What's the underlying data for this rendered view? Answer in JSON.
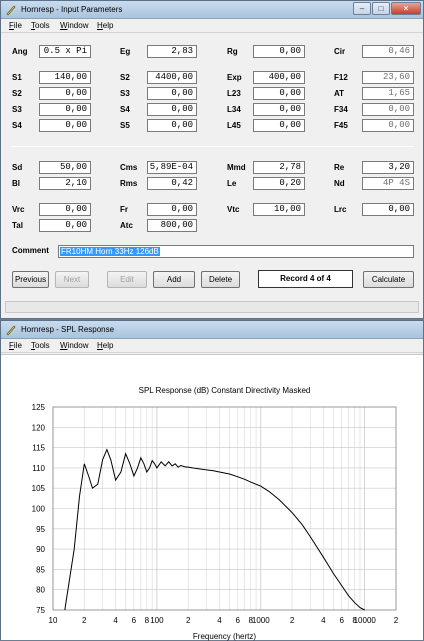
{
  "input_window": {
    "title": "Hornresp - Input Parameters",
    "menu": [
      "File",
      "Tools",
      "Window",
      "Help"
    ],
    "params_top": [
      {
        "id": "ang",
        "label": "Ang",
        "value": "0.5 x Pi"
      },
      {
        "id": "eg",
        "label": "Eg",
        "value": "2,83"
      },
      {
        "id": "rg",
        "label": "Rg",
        "value": "0,00"
      },
      {
        "id": "cir",
        "label": "Cir",
        "value": "0,46",
        "readonly": true
      },
      {
        "id": "s1",
        "label": "S1",
        "value": "140,00"
      },
      {
        "id": "s2a",
        "label": "S2",
        "value": "4400,00"
      },
      {
        "id": "exp",
        "label": "Exp",
        "value": "400,00"
      },
      {
        "id": "f12",
        "label": "F12",
        "value": "23,60",
        "readonly": true
      },
      {
        "id": "s2",
        "label": "S2",
        "value": "0,00"
      },
      {
        "id": "s3a",
        "label": "S3",
        "value": "0,00"
      },
      {
        "id": "l23",
        "label": "L23",
        "value": "0,00"
      },
      {
        "id": "at",
        "label": "AT",
        "value": "1,65",
        "readonly": true
      },
      {
        "id": "s3",
        "label": "S3",
        "value": "0,00"
      },
      {
        "id": "s4a",
        "label": "S4",
        "value": "0,00"
      },
      {
        "id": "l34",
        "label": "L34",
        "value": "0,00"
      },
      {
        "id": "f34",
        "label": "F34",
        "value": "0,00",
        "readonly": true
      },
      {
        "id": "s4",
        "label": "S4",
        "value": "0,00"
      },
      {
        "id": "s5",
        "label": "S5",
        "value": "0,00"
      },
      {
        "id": "l45",
        "label": "L45",
        "value": "0,00"
      },
      {
        "id": "f45",
        "label": "F45",
        "value": "0,00",
        "readonly": true
      }
    ],
    "params_bottom": [
      {
        "id": "sd",
        "label": "Sd",
        "value": "50,00"
      },
      {
        "id": "cms",
        "label": "Cms",
        "value": "5,89E-04"
      },
      {
        "id": "mmd",
        "label": "Mmd",
        "value": "2,78"
      },
      {
        "id": "re",
        "label": "Re",
        "value": "3,20"
      },
      {
        "id": "bl",
        "label": "Bl",
        "value": "2,10"
      },
      {
        "id": "rms",
        "label": "Rms",
        "value": "0,42"
      },
      {
        "id": "le",
        "label": "Le",
        "value": "0,20"
      },
      {
        "id": "nd",
        "label": "Nd",
        "value": "4P 4S",
        "readonly": true
      },
      {
        "id": "vrc",
        "label": "Vrc",
        "value": "0,00"
      },
      {
        "id": "fr",
        "label": "Fr",
        "value": "0,00"
      },
      {
        "id": "vtc",
        "label": "Vtc",
        "value": "10,00"
      },
      {
        "id": "lrc",
        "label": "Lrc",
        "value": "0,00"
      },
      {
        "id": "tal",
        "label": "Tal",
        "value": "0,00"
      },
      {
        "id": "atc",
        "label": "Atc",
        "value": "800,00"
      }
    ],
    "comment_label": "Comment",
    "comment_value": "FR10HM Horn 33Hz 126dB",
    "buttons": {
      "previous": "Previous",
      "next": "Next",
      "edit": "Edit",
      "add": "Add",
      "delete": "Delete",
      "calculate": "Calculate"
    },
    "record": "Record 4 of 4"
  },
  "spl_window": {
    "title": "Hornresp - SPL Response",
    "menu": [
      "File",
      "Tools",
      "Window",
      "Help"
    ]
  },
  "chart_data": {
    "type": "line",
    "title": "SPL Response (dB)   Constant Directivity   Masked",
    "xlabel": "Frequency (hertz)",
    "ylabel": "",
    "x_scale": "log",
    "xlim": [
      10,
      20000
    ],
    "ylim": [
      75,
      125
    ],
    "yticks": [
      75,
      80,
      85,
      90,
      95,
      100,
      105,
      110,
      115,
      120,
      125
    ],
    "xtick_labels": [
      {
        "f": 10,
        "t": "10"
      },
      {
        "f": 20,
        "t": "2"
      },
      {
        "f": 40,
        "t": "4"
      },
      {
        "f": 60,
        "t": "6"
      },
      {
        "f": 80,
        "t": "8"
      },
      {
        "f": 100,
        "t": "100"
      },
      {
        "f": 200,
        "t": "2"
      },
      {
        "f": 400,
        "t": "4"
      },
      {
        "f": 600,
        "t": "6"
      },
      {
        "f": 800,
        "t": "8"
      },
      {
        "f": 1000,
        "t": "1000"
      },
      {
        "f": 2000,
        "t": "2"
      },
      {
        "f": 4000,
        "t": "4"
      },
      {
        "f": 6000,
        "t": "6"
      },
      {
        "f": 8000,
        "t": "8"
      },
      {
        "f": 10000,
        "t": "10000"
      },
      {
        "f": 20000,
        "t": "2"
      }
    ],
    "grid": true,
    "line_color": "#000000",
    "series": [
      {
        "x": [
          13,
          16,
          18,
          20,
          22,
          24,
          27,
          30,
          33,
          36,
          40,
          45,
          50,
          55,
          60,
          65,
          70,
          75,
          80,
          85,
          90,
          95,
          100,
          110,
          120,
          130,
          140,
          150,
          160,
          170,
          185,
          200,
          220,
          250,
          300,
          350,
          400,
          500,
          600,
          700,
          800,
          1000,
          1200,
          1500,
          2000,
          2500,
          3000,
          4000,
          5000,
          6000,
          7000,
          8000,
          9000,
          10000
        ],
        "y": [
          75,
          90,
          103,
          111,
          108,
          105,
          106,
          112,
          114.5,
          112,
          107,
          109,
          113.5,
          111,
          108,
          110,
          112.5,
          111,
          109,
          110,
          111.8,
          111,
          110,
          111.5,
          110.5,
          111.5,
          110.5,
          111,
          110.2,
          110.6,
          110.3,
          110.2,
          110,
          109.8,
          109.5,
          109.3,
          109,
          108.5,
          107.8,
          107.2,
          106.5,
          105.5,
          104.2,
          102.2,
          99,
          96,
          93,
          88,
          84,
          81,
          78.5,
          76.8,
          75.6,
          75
        ]
      }
    ]
  }
}
